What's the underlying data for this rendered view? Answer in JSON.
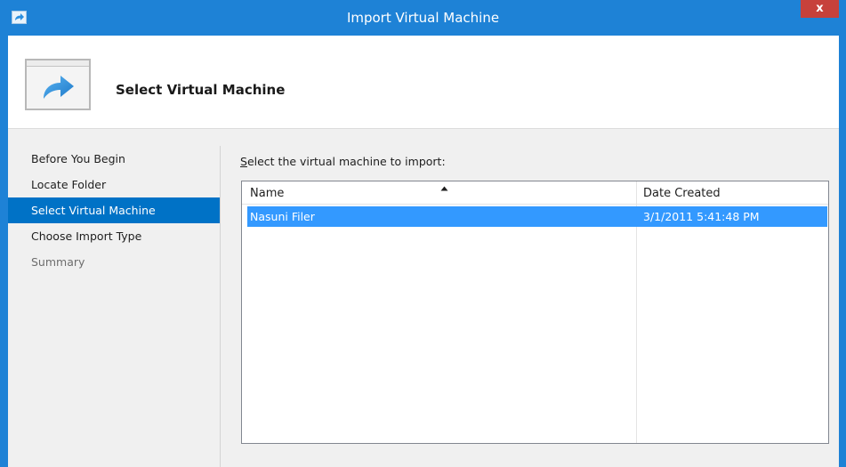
{
  "window": {
    "title": "Import Virtual Machine",
    "close_glyph": "x"
  },
  "header": {
    "icon": "import-arrow-icon",
    "title": "Select Virtual Machine"
  },
  "nav": {
    "items": [
      {
        "label": "Before You Begin",
        "state": "normal"
      },
      {
        "label": "Locate Folder",
        "state": "normal"
      },
      {
        "label": "Select Virtual Machine",
        "state": "selected"
      },
      {
        "label": "Choose Import Type",
        "state": "normal"
      },
      {
        "label": "Summary",
        "state": "disabled"
      }
    ]
  },
  "content": {
    "instruction_accesskey": "S",
    "instruction_rest": "elect the virtual machine to import:",
    "list": {
      "columns": [
        {
          "label": "Name",
          "sort": "ascending"
        },
        {
          "label": "Date Created"
        }
      ],
      "rows": [
        {
          "name": "Nasuni Filer",
          "date_created": "3/1/2011 5:41:48 PM",
          "selected": true
        }
      ]
    }
  },
  "colors": {
    "title_bar": "#1e82d6",
    "close_button": "#c7413b",
    "nav_selected": "#0072c6",
    "row_selected": "#3399ff"
  }
}
